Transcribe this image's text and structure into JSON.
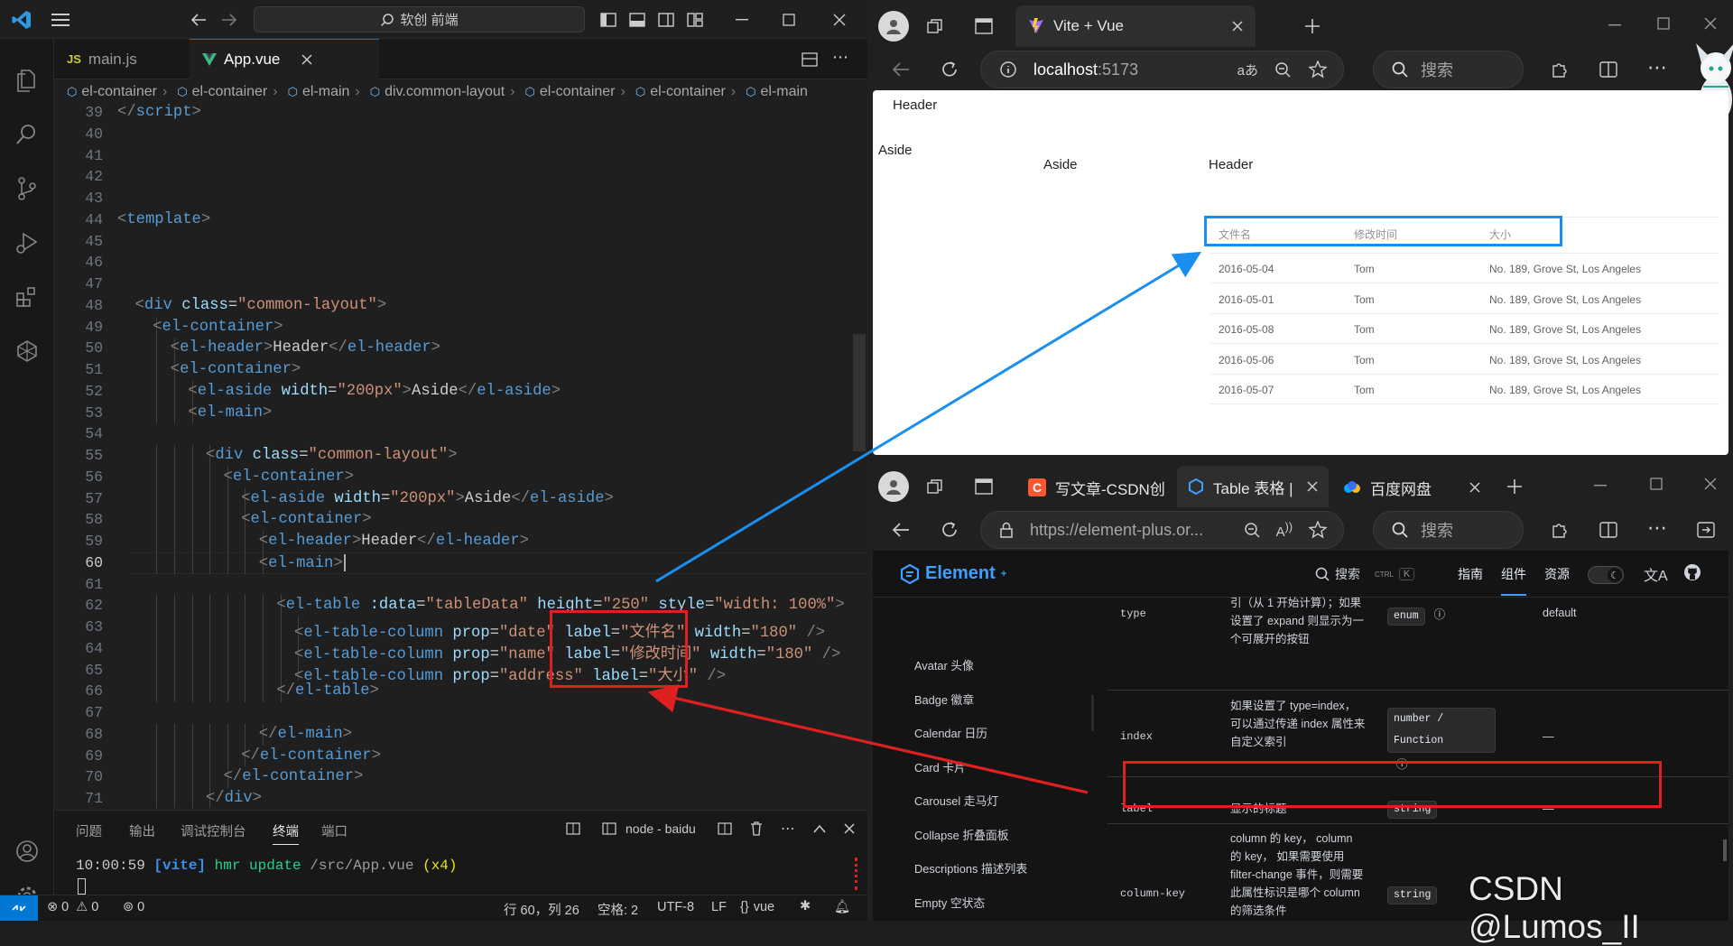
{
  "vscode": {
    "search_text": "软创 前端",
    "tabs": [
      {
        "label": "main.js",
        "prefix": "JS"
      },
      {
        "label": "App.vue"
      }
    ],
    "breadcrumb": [
      "el-container",
      "el-container",
      "el-main",
      "div.common-layout",
      "el-container",
      "el-container",
      "el-main"
    ],
    "code_lines": [
      {
        "n": "39",
        "parts": [
          [
            "pu",
            "</"
          ],
          [
            "tg",
            "script"
          ],
          [
            "pu",
            ">"
          ]
        ],
        "indent": 0
      },
      {
        "n": "40",
        "parts": [],
        "indent": 0
      },
      {
        "n": "41",
        "parts": [],
        "indent": 0
      },
      {
        "n": "42",
        "parts": [],
        "indent": 0
      },
      {
        "n": "43",
        "parts": [],
        "indent": 0
      },
      {
        "n": "44",
        "parts": [
          [
            "pu",
            "<"
          ],
          [
            "tg",
            "template"
          ],
          [
            "pu",
            ">"
          ]
        ],
        "indent": 0
      },
      {
        "n": "45",
        "parts": [],
        "indent": 0
      },
      {
        "n": "46",
        "parts": [],
        "indent": 0
      },
      {
        "n": "47",
        "parts": [],
        "indent": 0
      },
      {
        "n": "48",
        "parts": [
          [
            "pu",
            "<"
          ],
          [
            "tg",
            "div"
          ],
          [
            "tx",
            " "
          ],
          [
            "at",
            "class"
          ],
          [
            "tx",
            "="
          ],
          [
            "sv",
            "\"common-layout\""
          ],
          [
            "pu",
            ">"
          ]
        ],
        "indent": 1
      },
      {
        "n": "49",
        "parts": [
          [
            "pu",
            "<"
          ],
          [
            "tg",
            "el-container"
          ],
          [
            "pu",
            ">"
          ]
        ],
        "indent": 2
      },
      {
        "n": "50",
        "parts": [
          [
            "pu",
            "<"
          ],
          [
            "tg",
            "el-header"
          ],
          [
            "pu",
            ">"
          ],
          [
            "tx",
            "Header"
          ],
          [
            "pu",
            "</"
          ],
          [
            "tg",
            "el-header"
          ],
          [
            "pu",
            ">"
          ]
        ],
        "indent": 3
      },
      {
        "n": "51",
        "parts": [
          [
            "pu",
            "<"
          ],
          [
            "tg",
            "el-container"
          ],
          [
            "pu",
            ">"
          ]
        ],
        "indent": 3
      },
      {
        "n": "52",
        "parts": [
          [
            "pu",
            "<"
          ],
          [
            "tg",
            "el-aside"
          ],
          [
            "tx",
            " "
          ],
          [
            "at",
            "width"
          ],
          [
            "tx",
            "="
          ],
          [
            "sv",
            "\"200px\""
          ],
          [
            "pu",
            ">"
          ],
          [
            "tx",
            "Aside"
          ],
          [
            "pu",
            "</"
          ],
          [
            "tg",
            "el-aside"
          ],
          [
            "pu",
            ">"
          ]
        ],
        "indent": 4
      },
      {
        "n": "53",
        "parts": [
          [
            "pu",
            "<"
          ],
          [
            "tg",
            "el-main"
          ],
          [
            "pu",
            ">"
          ]
        ],
        "indent": 4
      },
      {
        "n": "54",
        "parts": [],
        "indent": 0
      },
      {
        "n": "55",
        "parts": [
          [
            "pu",
            "<"
          ],
          [
            "tg",
            "div"
          ],
          [
            "tx",
            " "
          ],
          [
            "at",
            "class"
          ],
          [
            "tx",
            "="
          ],
          [
            "sv",
            "\"common-layout\""
          ],
          [
            "pu",
            ">"
          ]
        ],
        "indent": 5
      },
      {
        "n": "56",
        "parts": [
          [
            "pu",
            "<"
          ],
          [
            "tg",
            "el-container"
          ],
          [
            "pu",
            ">"
          ]
        ],
        "indent": 6
      },
      {
        "n": "57",
        "parts": [
          [
            "pu",
            "<"
          ],
          [
            "tg",
            "el-aside"
          ],
          [
            "tx",
            " "
          ],
          [
            "at",
            "width"
          ],
          [
            "tx",
            "="
          ],
          [
            "sv",
            "\"200px\""
          ],
          [
            "pu",
            ">"
          ],
          [
            "tx",
            "Aside"
          ],
          [
            "pu",
            "</"
          ],
          [
            "tg",
            "el-aside"
          ],
          [
            "pu",
            ">"
          ]
        ],
        "indent": 7
      },
      {
        "n": "58",
        "parts": [
          [
            "pu",
            "<"
          ],
          [
            "tg",
            "el-container"
          ],
          [
            "pu",
            ">"
          ]
        ],
        "indent": 7
      },
      {
        "n": "59",
        "parts": [
          [
            "pu",
            "<"
          ],
          [
            "tg",
            "el-header"
          ],
          [
            "pu",
            ">"
          ],
          [
            "tx",
            "Header"
          ],
          [
            "pu",
            "</"
          ],
          [
            "tg",
            "el-header"
          ],
          [
            "pu",
            ">"
          ]
        ],
        "indent": 8
      },
      {
        "n": "60",
        "parts": [
          [
            "pu",
            "<"
          ],
          [
            "tg",
            "el-main"
          ],
          [
            "pu",
            ">"
          ]
        ],
        "indent": 8
      },
      {
        "n": "61",
        "parts": [],
        "indent": 0
      },
      {
        "n": "62",
        "parts": [
          [
            "pu",
            "<"
          ],
          [
            "tg",
            "el-table"
          ],
          [
            "tx",
            " "
          ],
          [
            "at",
            ":data"
          ],
          [
            "tx",
            "="
          ],
          [
            "sv",
            "\"tableData\""
          ],
          [
            "tx",
            " "
          ],
          [
            "at",
            "height"
          ],
          [
            "tx",
            "="
          ],
          [
            "sv",
            "\"250\""
          ],
          [
            "tx",
            " "
          ],
          [
            "at",
            "style"
          ],
          [
            "tx",
            "="
          ],
          [
            "sv",
            "\"width: 100%\""
          ],
          [
            "pu",
            ">"
          ]
        ],
        "indent": 9
      },
      {
        "n": "63",
        "parts": [
          [
            "pu",
            "<"
          ],
          [
            "tg",
            "el-table-column"
          ],
          [
            "tx",
            " "
          ],
          [
            "at",
            "prop"
          ],
          [
            "tx",
            "="
          ],
          [
            "sv",
            "\"date\""
          ],
          [
            "tx",
            " "
          ],
          [
            "at",
            "label"
          ],
          [
            "tx",
            "="
          ],
          [
            "sv",
            "\"文件名\""
          ],
          [
            "tx",
            " "
          ],
          [
            "at",
            "width"
          ],
          [
            "tx",
            "="
          ],
          [
            "sv",
            "\"180\""
          ],
          [
            "tx",
            " "
          ],
          [
            "pu",
            "/>"
          ]
        ],
        "indent": 10
      },
      {
        "n": "64",
        "parts": [
          [
            "pu",
            "<"
          ],
          [
            "tg",
            "el-table-column"
          ],
          [
            "tx",
            " "
          ],
          [
            "at",
            "prop"
          ],
          [
            "tx",
            "="
          ],
          [
            "sv",
            "\"name\""
          ],
          [
            "tx",
            " "
          ],
          [
            "at",
            "label"
          ],
          [
            "tx",
            "="
          ],
          [
            "sv",
            "\"修改时间\""
          ],
          [
            "tx",
            " "
          ],
          [
            "at",
            "width"
          ],
          [
            "tx",
            "="
          ],
          [
            "sv",
            "\"180\""
          ],
          [
            "tx",
            " "
          ],
          [
            "pu",
            "/>"
          ]
        ],
        "indent": 10
      },
      {
        "n": "65",
        "parts": [
          [
            "pu",
            "<"
          ],
          [
            "tg",
            "el-table-column"
          ],
          [
            "tx",
            " "
          ],
          [
            "at",
            "prop"
          ],
          [
            "tx",
            "="
          ],
          [
            "sv",
            "\"address\""
          ],
          [
            "tx",
            " "
          ],
          [
            "at",
            "label"
          ],
          [
            "tx",
            "="
          ],
          [
            "sv",
            "\"大小\""
          ],
          [
            "tx",
            " "
          ],
          [
            "pu",
            "/>"
          ]
        ],
        "indent": 10
      },
      {
        "n": "66",
        "parts": [
          [
            "pu",
            "</"
          ],
          [
            "tg",
            "el-table"
          ],
          [
            "pu",
            ">"
          ]
        ],
        "indent": 9
      },
      {
        "n": "67",
        "parts": [],
        "indent": 0
      },
      {
        "n": "68",
        "parts": [
          [
            "pu",
            "</"
          ],
          [
            "tg",
            "el-main"
          ],
          [
            "pu",
            ">"
          ]
        ],
        "indent": 8
      },
      {
        "n": "69",
        "parts": [
          [
            "pu",
            "</"
          ],
          [
            "tg",
            "el-container"
          ],
          [
            "pu",
            ">"
          ]
        ],
        "indent": 7
      },
      {
        "n": "70",
        "parts": [
          [
            "pu",
            "</"
          ],
          [
            "tg",
            "el-container"
          ],
          [
            "pu",
            ">"
          ]
        ],
        "indent": 6
      },
      {
        "n": "71",
        "parts": [
          [
            "pu",
            "</"
          ],
          [
            "tg",
            "div"
          ],
          [
            "pu",
            ">"
          ]
        ],
        "indent": 5
      }
    ],
    "panel_tabs": [
      "问题",
      "输出",
      "调试控制台",
      "终端",
      "端口"
    ],
    "terminal_name": "node - baidu",
    "terminal_line": {
      "time": "10:00:59",
      "tag": "[vite]",
      "msg": "hmr update",
      "path": "/src/App.vue",
      "count": "(x4)"
    },
    "status": {
      "errors": "0",
      "warnings": "0",
      "ports": "0",
      "position": "行 60，列 26",
      "spaces": "空格: 2",
      "encoding": "UTF-8",
      "eol": "LF",
      "lang": "vue"
    }
  },
  "browser1": {
    "tab_title": "Vite + Vue",
    "url_host": "localhost",
    "url_port": ":5173",
    "search_placeholder": "搜索",
    "page": {
      "outer_header": "Header",
      "outer_aside": "Aside",
      "inner_aside": "Aside",
      "inner_header": "Header",
      "table_headers": [
        "文件名",
        "修改时间",
        "大小"
      ],
      "table_rows": [
        [
          "2016-05-04",
          "Tom",
          "No. 189, Grove St, Los Angeles"
        ],
        [
          "2016-05-01",
          "Tom",
          "No. 189, Grove St, Los Angeles"
        ],
        [
          "2016-05-08",
          "Tom",
          "No. 189, Grove St, Los Angeles"
        ],
        [
          "2016-05-06",
          "Tom",
          "No. 189, Grove St, Los Angeles"
        ],
        [
          "2016-05-07",
          "Tom",
          "No. 189, Grove St, Los Angeles"
        ]
      ]
    }
  },
  "browser2": {
    "tabs": [
      "写文章-CSDN创",
      "Table 表格 | Ele",
      "百度网盘"
    ],
    "url": "https://element-plus.or...",
    "search_placeholder": "搜索",
    "site": {
      "logo": "Element",
      "logo_sup": "+",
      "search_label": "搜索",
      "search_keys": [
        "CTRL",
        "K"
      ],
      "nav": [
        "指南",
        "组件",
        "资源"
      ],
      "sidebar": [
        "Avatar 头像",
        "Badge 徽章",
        "Calendar 日历",
        "Card 卡片",
        "Carousel 走马灯",
        "Collapse 折叠面板",
        "Descriptions 描述列表",
        "Empty 空状态"
      ],
      "rows": [
        {
          "name": "type",
          "desc": "引（从 1 开始计算）；如果设置了 expand 则显示为一个可展开的按钮",
          "type": "enum",
          "default": "default"
        },
        {
          "name": "index",
          "desc": "如果设置了 type=index，可以通过传递 index 属性来自定义索引",
          "type": "number / Function",
          "default": "—"
        },
        {
          "name": "label",
          "desc": "显示的标题",
          "type": "string",
          "default": "—"
        },
        {
          "name": "column-key",
          "desc": "column 的 key， column 的 key， 如果需要使用 filter-change 事件，则需要此属性标识是哪个 column 的筛选条件",
          "type": "string",
          "default": ""
        }
      ]
    }
  },
  "watermark": "CSDN @Lumos_II",
  "colors": {
    "red_annotation": "#e02020",
    "blue_annotation": "#1a8ff0",
    "vscode_accent": "#0078d4"
  }
}
